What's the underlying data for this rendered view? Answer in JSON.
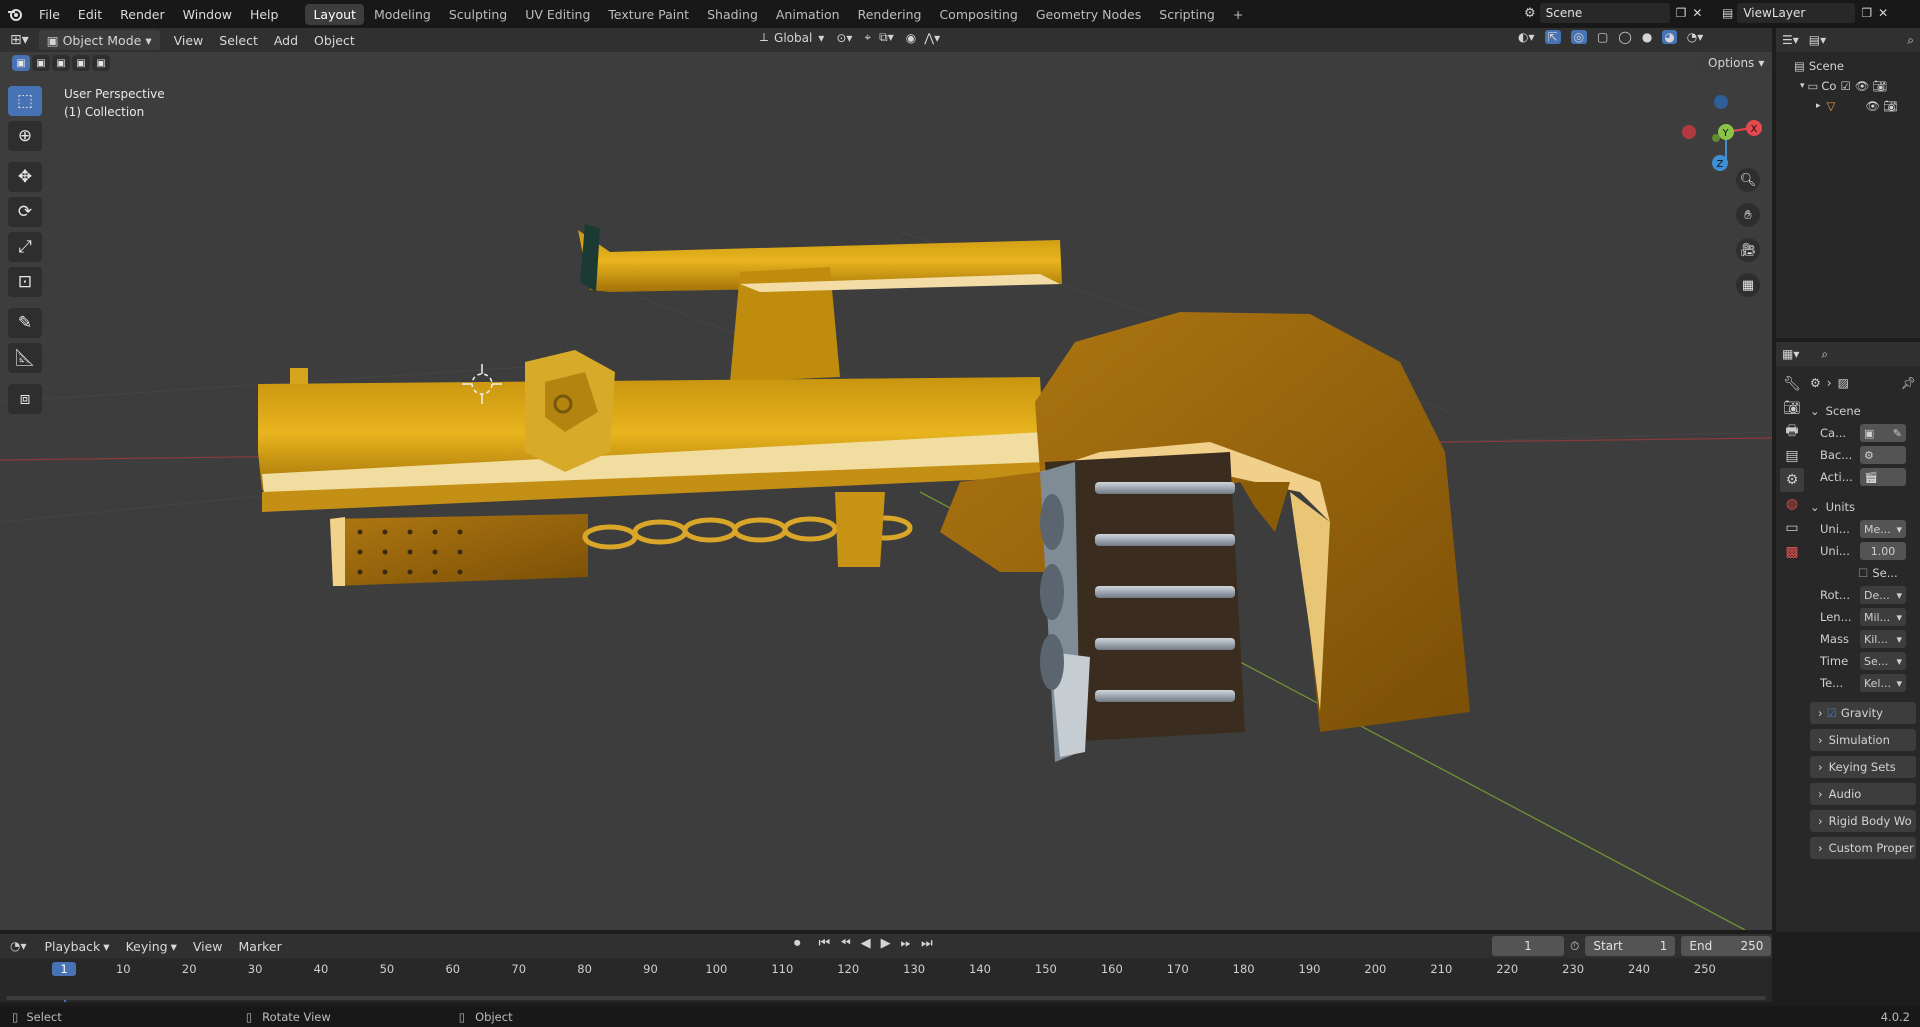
{
  "menu": [
    "File",
    "Edit",
    "Render",
    "Window",
    "Help"
  ],
  "workspaces": [
    "Layout",
    "Modeling",
    "Sculpting",
    "UV Editing",
    "Texture Paint",
    "Shading",
    "Animation",
    "Rendering",
    "Compositing",
    "Geometry Nodes",
    "Scripting"
  ],
  "active_workspace": "Layout",
  "scene_name": "Scene",
  "view_layer": "ViewLayer",
  "viewport_header": {
    "mode": "Object Mode",
    "menus": [
      "View",
      "Select",
      "Add",
      "Object"
    ],
    "transform_orientation": "Global",
    "options_label": "Options"
  },
  "viewport_overlay": {
    "perspective": "User Perspective",
    "collection": "(1) Collection"
  },
  "gizmo": {
    "x": "X",
    "y": "Y",
    "z": "Z"
  },
  "outliner": {
    "scene": "Scene",
    "collection_label": "Co"
  },
  "properties": {
    "scene_panel": "Scene",
    "rows_scene": [
      {
        "label": "Ca..."
      },
      {
        "label": "Bac..."
      },
      {
        "label": "Acti..."
      }
    ],
    "units_panel": "Units",
    "unit_system": {
      "label": "Uni...",
      "value": "Me..."
    },
    "unit_scale": {
      "label": "Uni...",
      "value": "1.00"
    },
    "separate_units": "Se...",
    "unit_rows": [
      {
        "label": "Rot...",
        "value": "De..."
      },
      {
        "label": "Len...",
        "value": "Mil..."
      },
      {
        "label": "Mass",
        "value": "Kil..."
      },
      {
        "label": "Time",
        "value": "Se..."
      },
      {
        "label": "Te...",
        "value": "Kel..."
      }
    ],
    "collapsed_panels": [
      "Gravity",
      "Simulation",
      "Keying Sets",
      "Audio",
      "Rigid Body Wo",
      "Custom Proper"
    ]
  },
  "timeline": {
    "menus": [
      "Playback",
      "Keying",
      "View",
      "Marker"
    ],
    "current_frame": "1",
    "start_label": "Start",
    "start_value": "1",
    "end_label": "End",
    "end_value": "250",
    "ticks": [
      "1",
      "10",
      "20",
      "30",
      "40",
      "50",
      "60",
      "70",
      "80",
      "90",
      "100",
      "110",
      "120",
      "130",
      "140",
      "150",
      "160",
      "170",
      "180",
      "190",
      "200",
      "210",
      "220",
      "230",
      "240",
      "250"
    ]
  },
  "status_bar": {
    "select": "Select",
    "rotate": "Rotate View",
    "object": "Object",
    "version": "4.0.2"
  },
  "colors": {
    "accent": "#4772b3",
    "gold": "#d9a21c",
    "axis_x": "#e5484d",
    "axis_y": "#8bc34a",
    "axis_z": "#3f8fd4"
  }
}
